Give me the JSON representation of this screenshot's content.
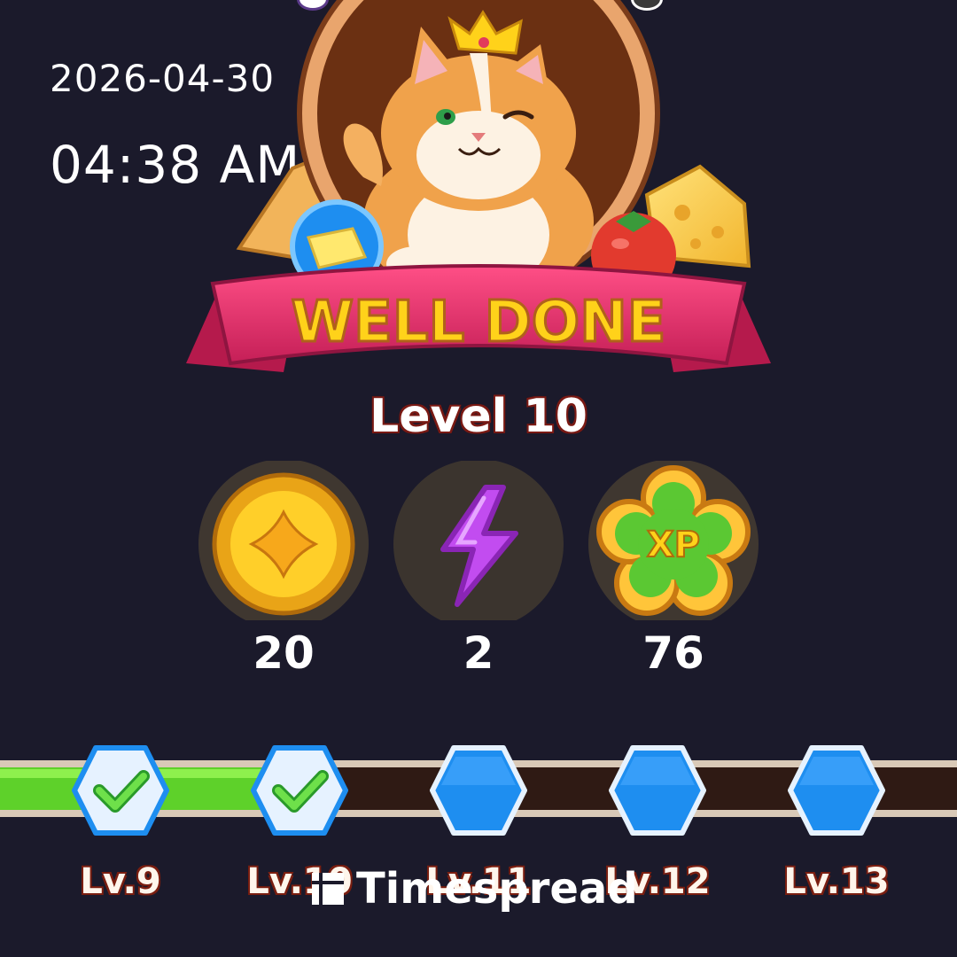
{
  "status": {
    "date": "2026-04-30",
    "time": "04:38 AM"
  },
  "banner": {
    "title": "WELL DONE",
    "character": "king-cat-icon",
    "items": [
      "butter-icon",
      "cheese-icon",
      "tomato-icon"
    ]
  },
  "level": {
    "title": "Level 10"
  },
  "rewards": [
    {
      "icon": "coin-icon",
      "value": "20"
    },
    {
      "icon": "energy-bolt-icon",
      "value": "2"
    },
    {
      "icon": "xp-flower-icon",
      "value": "76",
      "icon_text": "XP"
    }
  ],
  "progress": {
    "fraction_complete": 0.33,
    "levels": [
      {
        "label": "Lv.9",
        "completed": true
      },
      {
        "label": "Lv.10",
        "completed": true
      },
      {
        "label": "Lv.11",
        "completed": false
      },
      {
        "label": "Lv.12",
        "completed": false
      },
      {
        "label": "Lv.13",
        "completed": false
      }
    ]
  },
  "watermark": {
    "text": "Timespread"
  },
  "colors": {
    "background": "#1b1a2b",
    "ribbon": "#e8306a",
    "title_gold": "#ffd21a",
    "progress_fill": "#5ed12a",
    "progress_track": "#2f1a14",
    "node_blue": "#1e8ef0",
    "energy_purple": "#c24cf0"
  }
}
